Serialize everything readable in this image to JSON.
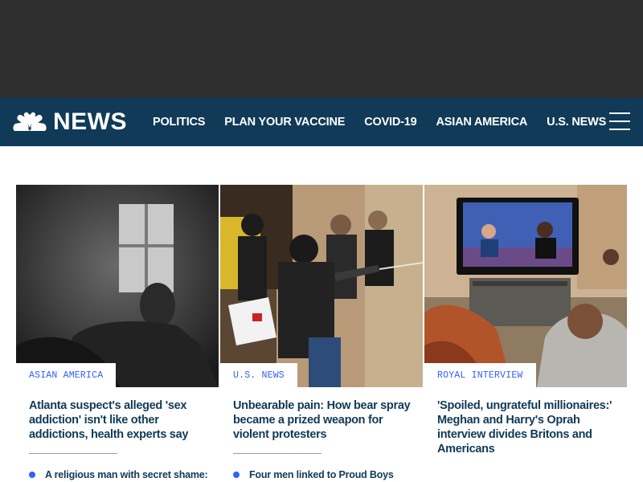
{
  "ad_area": {},
  "header": {
    "logo_text": "NEWS",
    "logo_icon": "nbc-peacock-icon",
    "nav_items": [
      "POLITICS",
      "PLAN YOUR VACCINE",
      "COVID-19",
      "ASIAN AMERICA",
      "U.S. NEWS"
    ],
    "menu_icon": "hamburger-menu-icon"
  },
  "colors": {
    "nav_background": "#103a57",
    "ad_background": "#2f2f2f",
    "accent_blue": "#3060ff",
    "headline_navy": "#103a57"
  },
  "cards": [
    {
      "tag": "ASIAN AMERICA",
      "headline": "Atlanta suspect's alleged 'sex addiction' isn't like other addictions, health experts say",
      "related": "A religious man with secret shame:"
    },
    {
      "tag": "U.S. NEWS",
      "headline": "Unbearable pain: How bear spray became a prized weapon for violent protesters",
      "related": "Four men linked to Proud Boys"
    },
    {
      "tag": "ROYAL INTERVIEW",
      "headline": "'Spoiled, ungrateful millionaires:' Meghan and Harry's Oprah interview divides Britons and Americans",
      "related": ""
    }
  ]
}
